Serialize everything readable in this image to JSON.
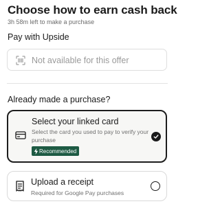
{
  "header": {
    "title": "Choose how to earn cash back",
    "subtitle": "3h 58m left to make a purchase"
  },
  "pay_with_upside": {
    "section_label": "Pay with Upside",
    "unavailable_text": "Not available for this offer",
    "icon": "qr-scan-icon"
  },
  "already_purchased": {
    "section_label": "Already made a purchase?",
    "options": [
      {
        "title": "Select your linked card",
        "description": "Select the card you used to pay to verify your purchase",
        "badge": "Recommended",
        "badge_icon": "bolt-icon",
        "icon": "credit-card-icon",
        "selected": true
      },
      {
        "title": "Upload a receipt",
        "description": "Required for Google Pay purchases",
        "icon": "receipt-icon",
        "selected": false
      }
    ]
  },
  "colors": {
    "badge_bg": "#1d5a43",
    "selected_border": "#1d1d1d",
    "muted_text": "#9a9a9a"
  }
}
